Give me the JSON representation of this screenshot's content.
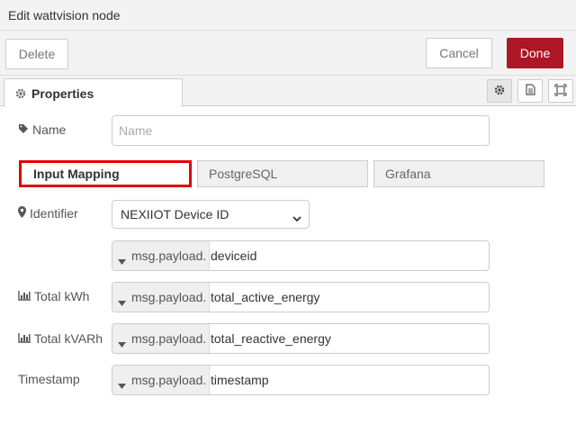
{
  "dialog": {
    "title": "Edit wattvision node"
  },
  "buttons": {
    "delete": "Delete",
    "cancel": "Cancel",
    "done": "Done"
  },
  "tabs": {
    "properties": "Properties"
  },
  "name_field": {
    "label": "Name",
    "placeholder": "Name"
  },
  "subtabs": [
    "Input Mapping",
    "PostgreSQL",
    "Grafana"
  ],
  "identifier": {
    "label": "Identifier",
    "selected": "NEXIIOT Device ID"
  },
  "mappings": [
    {
      "label": "",
      "prefix": "msg.payload.",
      "value": "deviceid"
    },
    {
      "label": "Total kWh",
      "prefix": "msg.payload.",
      "value": "total_active_energy"
    },
    {
      "label": "Total kVARh",
      "prefix": "msg.payload.",
      "value": "total_reactive_energy"
    },
    {
      "label": "Timestamp",
      "prefix": "msg.payload.",
      "value": "timestamp"
    }
  ],
  "colors": {
    "done_bg": "#ad1625",
    "highlight": "#e00000"
  },
  "icons": [
    "gear-icon",
    "document-icon",
    "frame-icon",
    "tag-icon",
    "map-marker-icon",
    "bar-chart-icon",
    "caret-down-icon",
    "chevron-down-icon"
  ]
}
